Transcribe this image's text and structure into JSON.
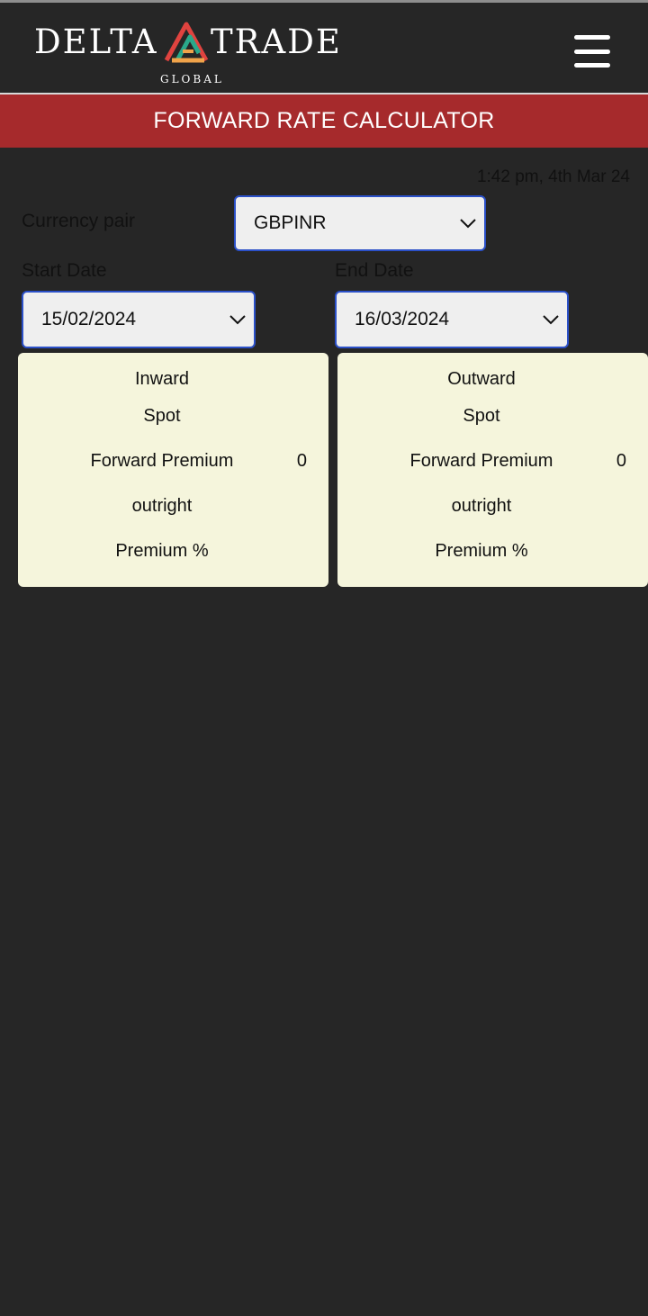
{
  "brand": {
    "name_left": "DELTA",
    "name_right": "TRADE",
    "subtitle": "GLOBAL",
    "logo_colors": [
      "#e0433f",
      "#2aa88a",
      "#f0a34a"
    ]
  },
  "header": {
    "menu_icon": "hamburger-menu-icon"
  },
  "banner": {
    "title": "FORWARD RATE CALCULATOR",
    "color": "#a62a2c"
  },
  "timestamp": "1:42 pm, 4th Mar 24",
  "form": {
    "currency_pair": {
      "label": "Currency pair",
      "value": "GBPINR"
    },
    "start_date": {
      "label": "Start Date",
      "value": "15/02/2024"
    },
    "end_date": {
      "label": "End Date",
      "value": "16/03/2024"
    }
  },
  "cards": [
    {
      "title": "Inward",
      "spot_label": "Spot",
      "forward_premium_label": "Forward Premium",
      "forward_premium_value": "0",
      "outright_label": "outright",
      "premium_pct_label": "Premium %"
    },
    {
      "title": "Outward",
      "spot_label": "Spot",
      "forward_premium_label": "Forward Premium",
      "forward_premium_value": "0",
      "outright_label": "outright",
      "premium_pct_label": "Premium %"
    }
  ]
}
